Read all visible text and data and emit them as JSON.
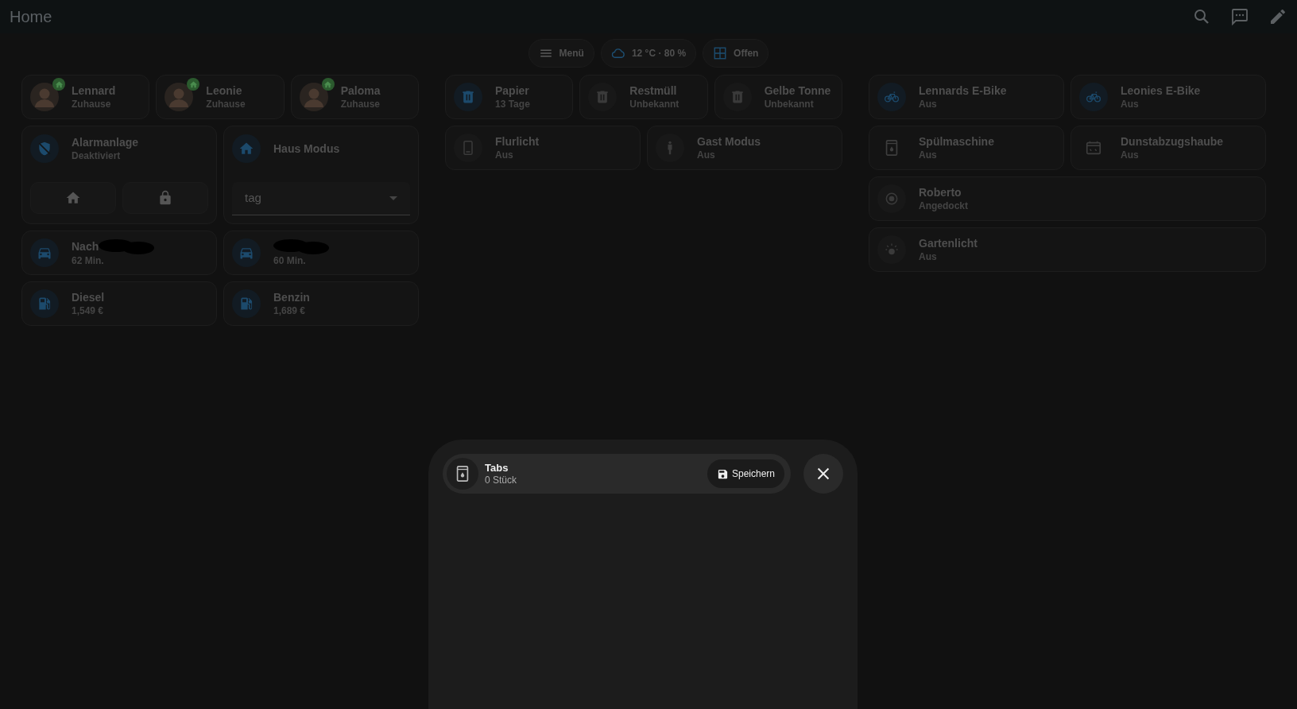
{
  "header": {
    "title": "Home"
  },
  "chips": [
    {
      "kind": "menu",
      "label": "Menü"
    },
    {
      "kind": "weather",
      "label": "12 °C · 80 %"
    },
    {
      "kind": "window",
      "label": "Offen"
    }
  ],
  "columns": [
    {
      "rows": [
        [
          {
            "kind": "person",
            "title": "Lennard",
            "state": "Zuhause",
            "home": true
          },
          {
            "kind": "person",
            "title": "Leonie",
            "state": "Zuhause",
            "home": true
          },
          {
            "kind": "person",
            "title": "Paloma",
            "state": "Zuhause",
            "home": true
          }
        ],
        [
          {
            "kind": "alarm",
            "title": "Alarmanlage",
            "state": "Deaktiviert",
            "active": true
          },
          {
            "kind": "select",
            "title": "Haus Modus",
            "value": "tag",
            "active": true
          }
        ],
        [
          {
            "kind": "car",
            "title": "Nach",
            "state": "62 Min.",
            "active": true,
            "redacted": true
          },
          {
            "kind": "car",
            "state": "60 Min.",
            "active": true,
            "redacted": true
          }
        ],
        [
          {
            "kind": "fuel",
            "title": "Diesel",
            "state": "1,549 €",
            "active": true
          },
          {
            "kind": "fuel",
            "title": "Benzin",
            "state": "1,689 €",
            "active": true
          }
        ]
      ]
    },
    {
      "rows": [
        [
          {
            "kind": "trash",
            "title": "Papier",
            "state": "13 Tage",
            "active": true
          },
          {
            "kind": "trash",
            "title": "Restmüll",
            "state": "Unbekannt",
            "active": false
          },
          {
            "kind": "trash",
            "title": "Gelbe Tonne",
            "state": "Unbekannt",
            "active": false
          }
        ],
        [
          {
            "kind": "phone",
            "title": "Flurlicht",
            "state": "Aus",
            "active": false
          },
          {
            "kind": "figure",
            "title": "Gast Modus",
            "state": "Aus",
            "active": false
          }
        ]
      ]
    },
    {
      "rows": [
        [
          {
            "kind": "bike",
            "title": "Lennards E-Bike",
            "state": "Aus",
            "active": true
          },
          {
            "kind": "bike",
            "title": "Leonies E-Bike",
            "state": "Aus",
            "active": true
          }
        ],
        [
          {
            "kind": "dishwasher",
            "title": "Spülmaschine",
            "state": "Aus",
            "active": false,
            "bare": true
          },
          {
            "kind": "hood",
            "title": "Dunstabzugshaube",
            "state": "Aus",
            "active": false,
            "bare": true
          }
        ],
        [
          {
            "kind": "vacuum",
            "title": "Roberto",
            "state": "Angedockt",
            "active": false
          }
        ],
        [
          {
            "kind": "light",
            "title": "Gartenlicht",
            "state": "Aus",
            "active": false
          }
        ]
      ]
    }
  ],
  "dialog": {
    "title": "Tabs",
    "subtitle": "0 Stück",
    "save_label": "Speichern"
  }
}
